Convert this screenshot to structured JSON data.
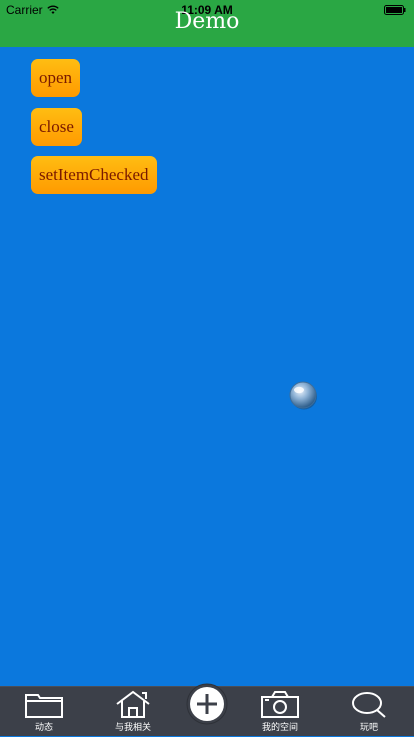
{
  "status_bar": {
    "carrier": "Carrier",
    "time": "11:09 AM",
    "icons": [
      "wifi-icon",
      "battery-icon"
    ]
  },
  "nav": {
    "title": "Demo"
  },
  "buttons": {
    "open": "open",
    "close": "close",
    "set_item_checked": "setItemChecked"
  },
  "tab_bar": {
    "items": [
      {
        "label": "动态",
        "icon": "folder-icon"
      },
      {
        "label": "与我相关",
        "icon": "home-icon"
      },
      {
        "label": "",
        "icon": "plus-icon"
      },
      {
        "label": "我的空间",
        "icon": "camera-icon"
      },
      {
        "label": "玩吧",
        "icon": "search-icon"
      }
    ]
  },
  "colors": {
    "status_and_nav": "#2aa744",
    "background": "#0b78dd",
    "button_gradient_top": "#ffbd12",
    "button_gradient_bottom": "#ff9a00",
    "button_text": "#7a1a00",
    "tab_bar": "#3c4049"
  }
}
